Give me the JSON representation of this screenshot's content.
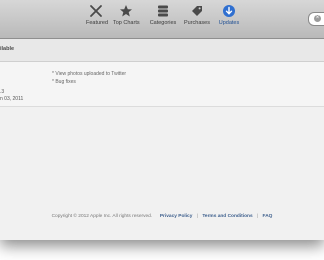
{
  "toolbar": {
    "items": [
      {
        "label": "Featured",
        "icon": "featured-icon"
      },
      {
        "label": "Top Charts",
        "icon": "star-icon"
      },
      {
        "label": "Categories",
        "icon": "categories-icon"
      },
      {
        "label": "Purchases",
        "icon": "tag-icon"
      },
      {
        "label": "Updates",
        "icon": "updates-icon",
        "active": true
      }
    ],
    "search_clear_glyph": "×"
  },
  "section": {
    "title": "ilable"
  },
  "update": {
    "version_fragment": ".3",
    "date_fragment": "n 03, 2011",
    "notes": [
      "* View photos uploaded to Twitter",
      "* Bug fixes"
    ]
  },
  "footer": {
    "copyright": "Copyright © 2012 Apple Inc. All rights reserved.",
    "privacy": "Privacy Policy",
    "terms": "Terms and Conditions",
    "faq": "FAQ",
    "separator": "|"
  },
  "colors": {
    "accent": "#1f4f93",
    "link": "#3c5e8c"
  }
}
